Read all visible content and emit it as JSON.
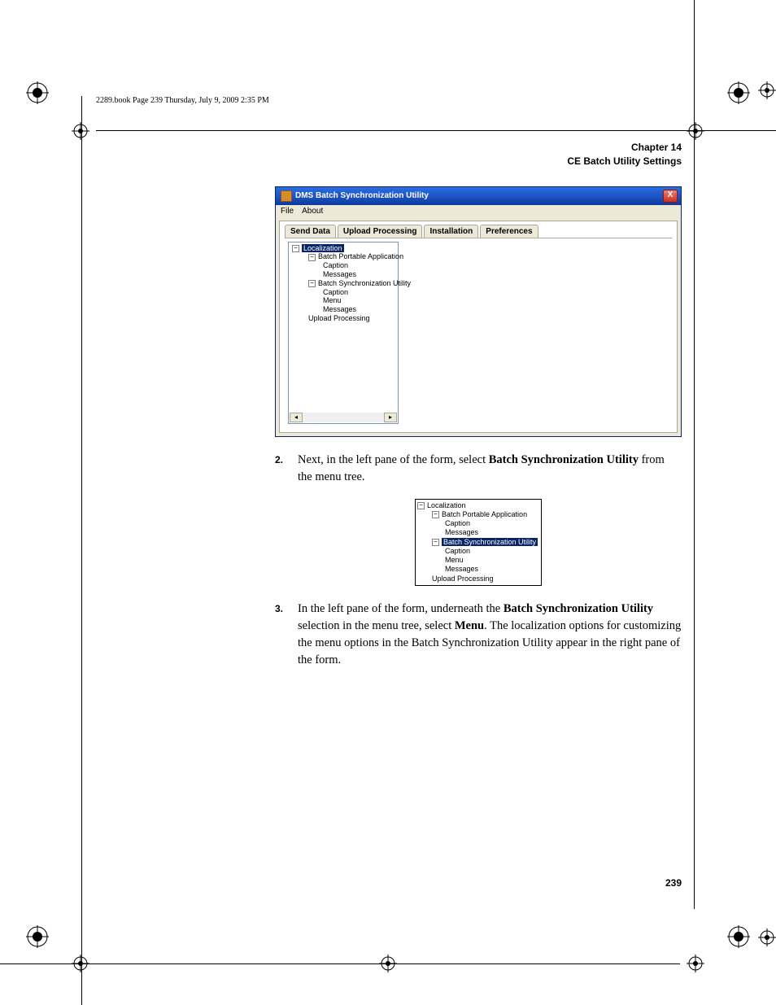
{
  "book_line": "2289.book  Page 239  Thursday, July 9, 2009  2:35 PM",
  "header": {
    "line1": "Chapter 14",
    "line2": "CE Batch Utility Settings"
  },
  "dialog": {
    "title": "DMS Batch Synchronization Utility",
    "close": "X",
    "menu": [
      "File",
      "About"
    ],
    "tabs": [
      "Send Data",
      "Upload Processing",
      "Installation",
      "Preferences"
    ],
    "tree1": {
      "root": "Localization",
      "bpa": "Batch Portable Application",
      "caption": "Caption",
      "messages": "Messages",
      "bsu": "Batch Synchronization Utility",
      "menu": "Menu",
      "upload": "Upload Processing"
    },
    "scroll_left": "◂",
    "scroll_right": "▸"
  },
  "step2": {
    "num": "2.",
    "text_a": "Next, in the left pane of the form, select ",
    "bold_a": "Batch Synchronization Utility",
    "text_b": " from the menu tree."
  },
  "mini": {
    "root": "Localization",
    "bpa": "Batch Portable Application",
    "caption": "Caption",
    "messages": "Messages",
    "bsu": "Batch Synchronization Utility",
    "menu": "Menu",
    "upload": "Upload Processing"
  },
  "step3": {
    "num": "3.",
    "text_a": "In the left pane of the form, underneath the ",
    "bold_a": "Batch Synchronization Utility",
    "text_b": " selection in the menu tree, select ",
    "bold_b": "Menu",
    "text_c": ". The localization options for customizing the menu options in the Batch Synchronization Utility appear in the right pane of the form."
  },
  "page_number": "239"
}
